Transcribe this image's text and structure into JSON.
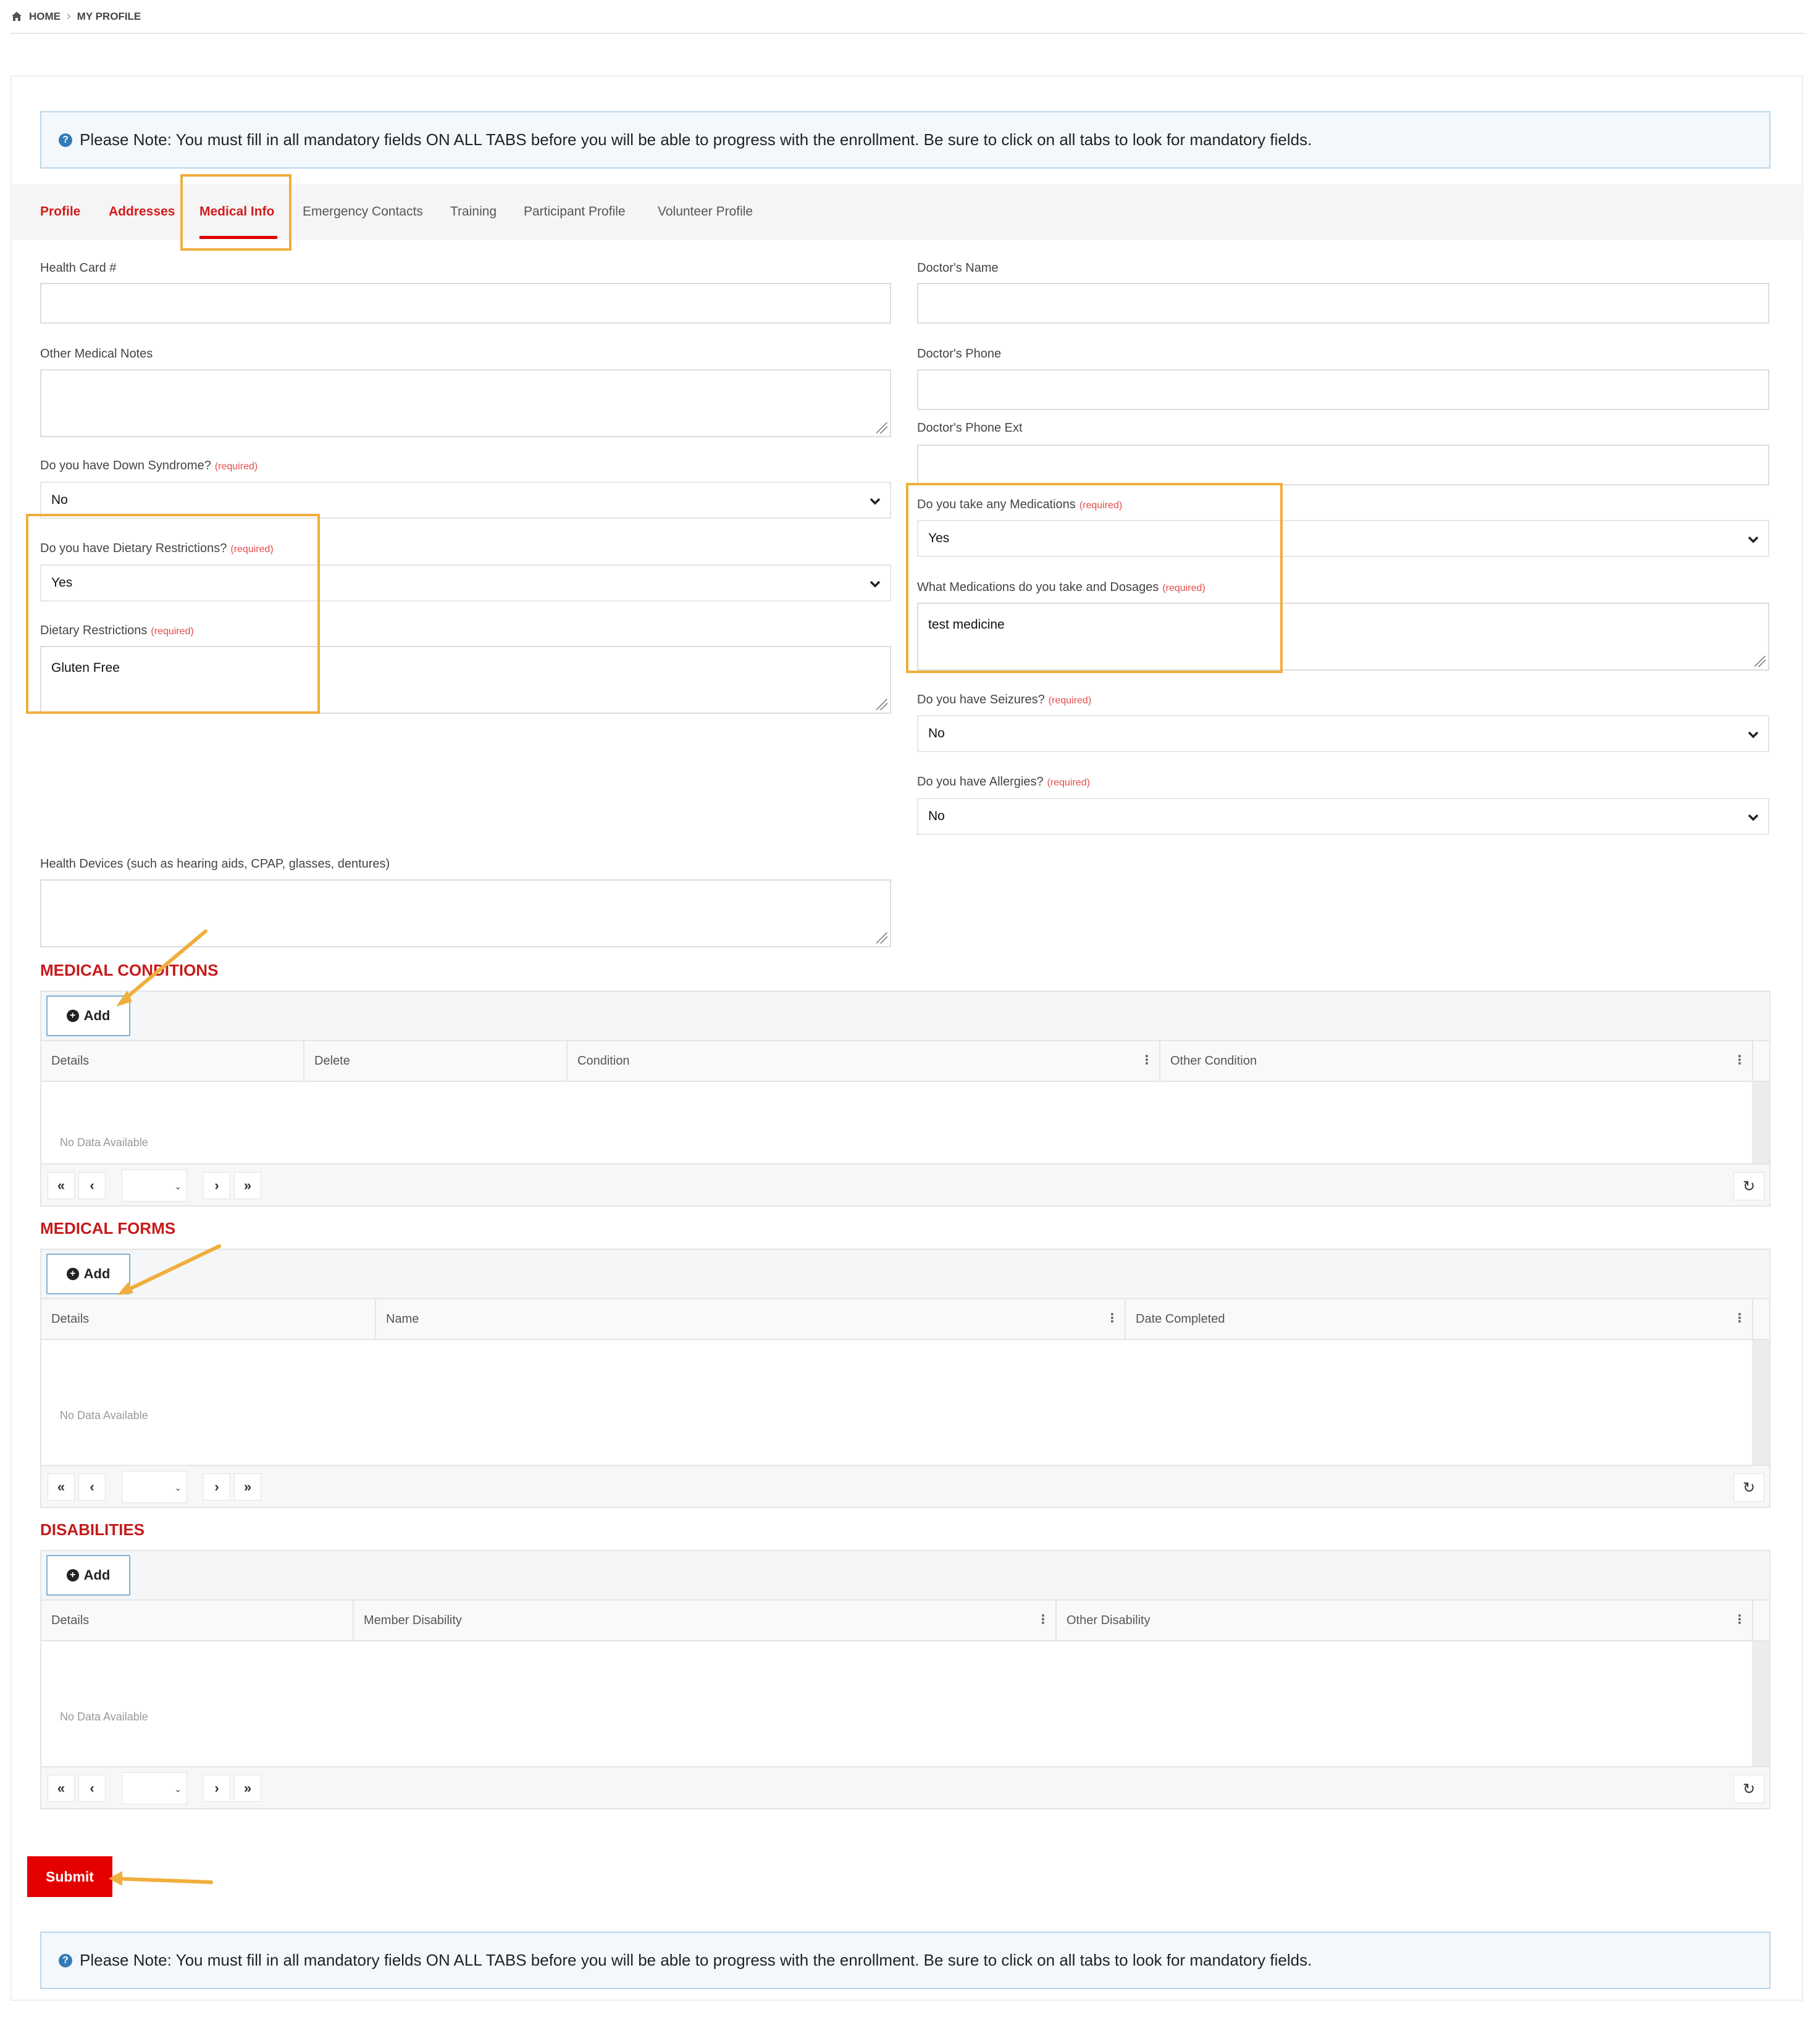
{
  "breadcrumb": {
    "home": "HOME",
    "current": "MY PROFILE"
  },
  "notice": "Please Note: You must fill in all mandatory fields ON ALL TABS before you will be able to progress with the enrollment. Be sure to click on all tabs to look for mandatory fields.",
  "tabs": [
    {
      "label": "Profile"
    },
    {
      "label": "Addresses"
    },
    {
      "label": "Medical Info"
    },
    {
      "label": "Emergency Contacts"
    },
    {
      "label": "Training"
    },
    {
      "label": "Participant Profile"
    },
    {
      "label": "Volunteer Profile"
    }
  ],
  "required_tag": "(required)",
  "form": {
    "health_card": {
      "label": "Health Card #",
      "value": ""
    },
    "other_notes": {
      "label": "Other Medical Notes",
      "value": ""
    },
    "down_syndrome": {
      "label": "Do you have Down Syndrome?",
      "value": "No"
    },
    "dietary": {
      "label": "Do you have Dietary Restrictions?",
      "value": "Yes"
    },
    "dietary_text": {
      "label": "Dietary Restrictions",
      "value": "Gluten Free"
    },
    "health_devices": {
      "label": "Health Devices (such as hearing aids, CPAP, glasses, dentures)",
      "value": ""
    },
    "doctor_name": {
      "label": "Doctor's Name",
      "value": ""
    },
    "doctor_phone": {
      "label": "Doctor's Phone",
      "value": ""
    },
    "doctor_ext": {
      "label": "Doctor's Phone Ext",
      "value": ""
    },
    "medications": {
      "label": "Do you take any Medications",
      "value": "Yes"
    },
    "medications_text": {
      "label": "What Medications do you take and Dosages",
      "value": "test medicine"
    },
    "seizures": {
      "label": "Do you have Seizures?",
      "value": "No"
    },
    "allergies": {
      "label": "Do you have Allergies?",
      "value": "No"
    }
  },
  "grids": {
    "add_label": "Add",
    "empty_text": "No Data Available",
    "conditions": {
      "title": "MEDICAL CONDITIONS",
      "columns": [
        "Details",
        "Delete",
        "Condition",
        "Other Condition"
      ]
    },
    "forms": {
      "title": "MEDICAL FORMS",
      "columns": [
        "Details",
        "Name",
        "Date Completed"
      ]
    },
    "disabilities": {
      "title": "DISABILITIES",
      "columns": [
        "Details",
        "Member Disability",
        "Other Disability"
      ]
    }
  },
  "submit_label": "Submit",
  "colors": {
    "accent_red": "#d21b1b",
    "submit_red": "#e50000",
    "highlight": "#f0ae3c",
    "info_blue": "#337ab7"
  }
}
